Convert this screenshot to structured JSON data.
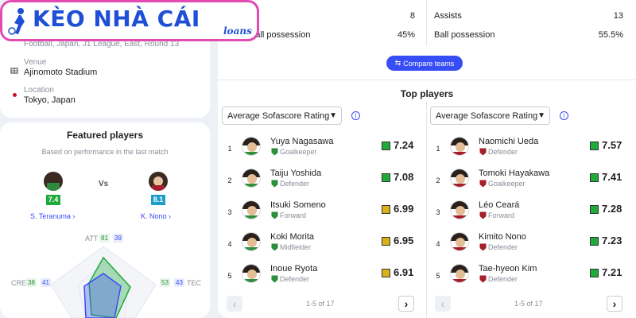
{
  "logo": {
    "main": "KÈO NHÀ CÁI",
    "sub": "loans"
  },
  "match_info": {
    "competition": "Football, Japan, J1 League, East, Round 13",
    "venue_label": "Venue",
    "venue": "Ajinomoto Stadium",
    "location_label": "Location",
    "location": "Tokyo, Japan"
  },
  "stats": {
    "left": [
      {
        "label": "",
        "value": "8"
      },
      {
        "label": "Ball possession",
        "value": "45%"
      }
    ],
    "right": [
      {
        "label": "Assists",
        "value": "13"
      },
      {
        "label": "Ball possession",
        "value": "55.5%"
      }
    ],
    "compare_button": "Compare teams"
  },
  "featured": {
    "title": "Featured players",
    "subtitle": "Based on performance in the last match",
    "vs": "Vs",
    "player1": {
      "name": "S. Teranuma",
      "rating": "7.4",
      "badge_color": "#1faa3c"
    },
    "player2": {
      "name": "K. Nono",
      "rating": "8.1",
      "badge_color": "#1d9ec9"
    },
    "attributes": {
      "att": {
        "label": "ATT",
        "p1": "81",
        "p2": "39"
      },
      "cre": {
        "label": "CRE",
        "p1": "38",
        "p2": "41"
      },
      "tec": {
        "label": "TEC",
        "p1": "53",
        "p2": "43"
      }
    }
  },
  "top_players": {
    "title": "Top players",
    "left_select": "Average Sofascore Rating",
    "right_select": "Average Sofascore Rating",
    "left_list": [
      {
        "rank": "1",
        "name": "Yuya Nagasawa",
        "position": "Goalkeeper",
        "rating": "7.24",
        "color": "#1faa3c"
      },
      {
        "rank": "2",
        "name": "Taiju Yoshida",
        "position": "Defender",
        "rating": "7.08",
        "color": "#1faa3c"
      },
      {
        "rank": "3",
        "name": "Itsuki Someno",
        "position": "Forward",
        "rating": "6.99",
        "color": "#d8b21c"
      },
      {
        "rank": "4",
        "name": "Koki Morita",
        "position": "Midfielder",
        "rating": "6.95",
        "color": "#d8b21c"
      },
      {
        "rank": "5",
        "name": "Inoue Ryota",
        "position": "Defender",
        "rating": "6.91",
        "color": "#d8b21c"
      }
    ],
    "right_list": [
      {
        "rank": "1",
        "name": "Naomichi Ueda",
        "position": "Defender",
        "rating": "7.57",
        "color": "#1faa3c"
      },
      {
        "rank": "2",
        "name": "Tomoki Hayakawa",
        "position": "Goalkeeper",
        "rating": "7.41",
        "color": "#1faa3c"
      },
      {
        "rank": "3",
        "name": "Léo Ceará",
        "position": "Forward",
        "rating": "7.28",
        "color": "#1faa3c"
      },
      {
        "rank": "4",
        "name": "Kimito Nono",
        "position": "Defender",
        "rating": "7.23",
        "color": "#1faa3c"
      },
      {
        "rank": "5",
        "name": "Tae-hyeon Kim",
        "position": "Defender",
        "rating": "7.21",
        "color": "#1faa3c"
      }
    ],
    "left_pager": "1-5 of 17",
    "right_pager": "1-5 of 17"
  },
  "colors": {
    "accent": "#374df5",
    "logo_border": "#e24bb2",
    "logo_text": "#1e4fd6"
  }
}
